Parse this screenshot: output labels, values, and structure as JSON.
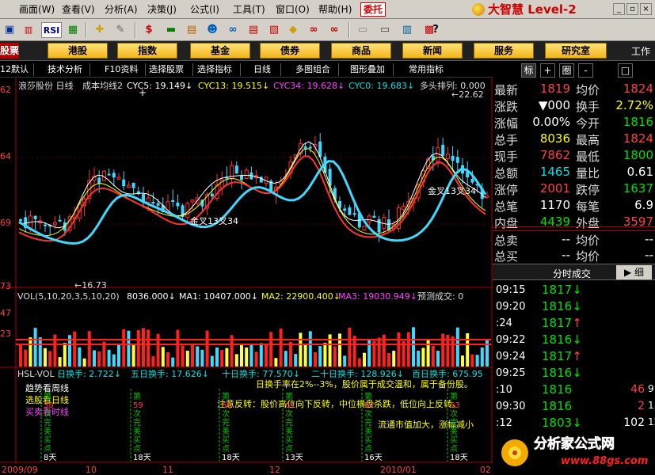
{
  "menubar": {
    "items": [
      "画面(W)",
      "查看(V)",
      "分析(A)",
      "决策(J)",
      "公式(I)",
      "工具(T)",
      "窗口(O)",
      "帮助(H)"
    ],
    "trade_button": "委托",
    "brand": "大智慧 Level-2"
  },
  "toolbar": {
    "items": [
      "RSI"
    ]
  },
  "navbar": {
    "left_label": "股票",
    "buttons": [
      "港股",
      "指数",
      "基金",
      "债券",
      "商品",
      "新闻",
      "服务",
      "研究室"
    ],
    "right_label": "工作"
  },
  "subtoolbar": {
    "items": [
      "12默认",
      "技术分析",
      "F10资料",
      "选择股票",
      "选择指标",
      "日线",
      "多图组合",
      "图形叠加",
      "常用指标"
    ]
  },
  "right_tabs": [
    "标",
    "+",
    "圈",
    "-",
    "□"
  ],
  "main_chart": {
    "title": "浪莎股份 日线",
    "indicator": "成本均线2",
    "legend": [
      {
        "label": "CYC5: 19.149↓",
        "color": "#ffffff"
      },
      {
        "label": "CYC13: 19.515↓",
        "color": "#ffff00"
      },
      {
        "label": "CYC34: 19.628↓",
        "color": "#ff40ff"
      },
      {
        "label": "CYC0: 19.683↓",
        "color": "#00e0e0"
      },
      {
        "label": "多头排列: 0.000",
        "color": "#dcdcdc"
      }
    ],
    "y_labels": [
      "22.62",
      "19.64",
      "16.73"
    ],
    "y_labels_left": [
      "62",
      "64",
      "69",
      "73"
    ],
    "max_label": "22.62",
    "min_label": "16.73",
    "annotations": [
      "金叉13叉34",
      "金叉13叉34"
    ]
  },
  "volume_chart": {
    "title": "VOL(5,10,20,3,5,10,20)",
    "legend": [
      {
        "label": "8036.000↓",
        "color": "#ffffff"
      },
      {
        "label": "MA1: 10407.000↓",
        "color": "#ffffff"
      },
      {
        "label": "MA2: 22900.400↓",
        "color": "#ffff00"
      },
      {
        "label": "MA3: 19030.949↓",
        "color": "#ff40ff"
      },
      {
        "label": "预测成交: 0",
        "color": "#dcdcdc"
      }
    ],
    "y_labels": [
      "47",
      "23"
    ]
  },
  "hsl_chart": {
    "title": "HSL-VOL",
    "legend": [
      {
        "label": "日换手: 2.722↓",
        "color": "#00e0e0"
      },
      {
        "label": "五日换手: 17.626↓",
        "color": "#00e0e0"
      },
      {
        "label": "十日换手: 77.570↓",
        "color": "#00e0e0"
      },
      {
        "label": "二十日换手: 128.926↓",
        "color": "#00e0e0"
      },
      {
        "label": "百日换手: 675.95",
        "color": "#00e0e0"
      }
    ],
    "notes": [
      {
        "label": "趋势看周线",
        "color": "#ffffff"
      },
      {
        "label": "选股看日线",
        "color": "#ffff00"
      },
      {
        "label": "买卖看时线",
        "color": "#ff40ff"
      }
    ],
    "comment1": "日换手率在2%--3%，股价属于成交温和，属于备份股。",
    "comment2": "注意反转：股价高位向下反转，中位横盘杀跌，低位向上反转。",
    "comment3": "流通市值加大，涨幅减小",
    "signal_columns": [
      {
        "lines": [
          "第",
          "58",
          "次",
          "完",
          "美",
          "买",
          "点",
          "8天"
        ]
      },
      {
        "lines": [
          "第",
          "59",
          "次",
          "完",
          "美",
          "买",
          "点",
          "18天"
        ]
      },
      {
        "lines": [
          "第",
          "60",
          "次",
          "完",
          "美",
          "买",
          "点",
          "18天"
        ]
      },
      {
        "lines": [
          "第",
          "61",
          "次",
          "完",
          "美",
          "买",
          "点",
          "13天"
        ]
      },
      {
        "lines": [
          "第",
          "62",
          "次",
          "完",
          "美",
          "买",
          "点",
          "16天"
        ]
      },
      {
        "lines": [
          "第",
          "63",
          "次",
          "完",
          "美",
          "买",
          "点",
          "18天"
        ]
      }
    ]
  },
  "x_axis": [
    "2009/09",
    "10",
    "11",
    "12",
    "2010/01",
    "02"
  ],
  "quote": {
    "rows": [
      {
        "l1": "最新",
        "v1": "1819",
        "c1": "red",
        "l2": "均价",
        "v2": "1824",
        "c2": "red"
      },
      {
        "l1": "涨跌",
        "v1": "▼000",
        "c1": "white",
        "l2": "换手",
        "v2": "2.72%",
        "c2": "yellow"
      },
      {
        "l1": "涨幅",
        "v1": "0.00%",
        "c1": "white",
        "l2": "今开",
        "v2": "1816",
        "c2": "green"
      },
      {
        "l1": "总手",
        "v1": "8036",
        "c1": "yellow",
        "l2": "最高",
        "v2": "1824",
        "c2": "red"
      },
      {
        "l1": "现手",
        "v1": "7862",
        "c1": "red",
        "l2": "最低",
        "v2": "1800",
        "c2": "green"
      },
      {
        "l1": "总额",
        "v1": "1465",
        "c1": "cyan",
        "l2": "量比",
        "v2": "0.61",
        "c2": "white"
      },
      {
        "l1": "涨停",
        "v1": "2001",
        "c1": "red",
        "l2": "跌停",
        "v2": "1637",
        "c2": "green"
      },
      {
        "l1": "总笔",
        "v1": "1170",
        "c1": "white",
        "l2": "每笔",
        "v2": "6.9",
        "c2": "white"
      },
      {
        "l1": "内盘",
        "v1": "4439",
        "c1": "green",
        "l2": "外盘",
        "v2": "3597",
        "c2": "red"
      },
      {
        "l1": "总卖",
        "v1": "--",
        "c1": "white",
        "l2": "均价",
        "v2": "--",
        "c2": "white"
      },
      {
        "l1": "总买",
        "v1": "--",
        "c1": "white",
        "l2": "均价",
        "v2": "--",
        "c2": "white"
      }
    ]
  },
  "ticks": {
    "header": "分时成交",
    "detail_label": "细",
    "rows": [
      {
        "t": "09:15",
        "p": "1817",
        "pc": "green",
        "arrow": "↓",
        "ac": "green",
        "v": "",
        "d": ""
      },
      {
        "t": "09:20",
        "p": "1816",
        "pc": "green",
        "arrow": "↓",
        "ac": "green",
        "v": "",
        "d": ""
      },
      {
        "t": ":24",
        "p": "1817",
        "pc": "green",
        "arrow": "↑",
        "ac": "red",
        "v": "",
        "d": ""
      },
      {
        "t": "09:22",
        "p": "1816",
        "pc": "green",
        "arrow": "↓",
        "ac": "green",
        "v": "",
        "d": ""
      },
      {
        "t": "09:24",
        "p": "1817",
        "pc": "green",
        "arrow": "↑",
        "ac": "red",
        "v": "",
        "d": ""
      },
      {
        "t": "09:25",
        "p": "1816",
        "pc": "green",
        "arrow": "↓",
        "ac": "green",
        "v": "",
        "d": ""
      },
      {
        "t": ":10",
        "p": "1816",
        "pc": "green",
        "arrow": "",
        "ac": "green",
        "v": "46",
        "vc": "red",
        "d": "9"
      },
      {
        "t": "09:30",
        "p": "1816",
        "pc": "green",
        "arrow": "",
        "ac": "green",
        "v": "2",
        "vc": "red",
        "d": "1"
      },
      {
        "t": ":12",
        "p": "1803",
        "pc": "green",
        "arrow": "↓",
        "ac": "green",
        "v": "102",
        "vc": "white",
        "d": "12"
      }
    ]
  },
  "watermark": {
    "line1": "分析家公式网",
    "line2": "www.88gs.com"
  }
}
